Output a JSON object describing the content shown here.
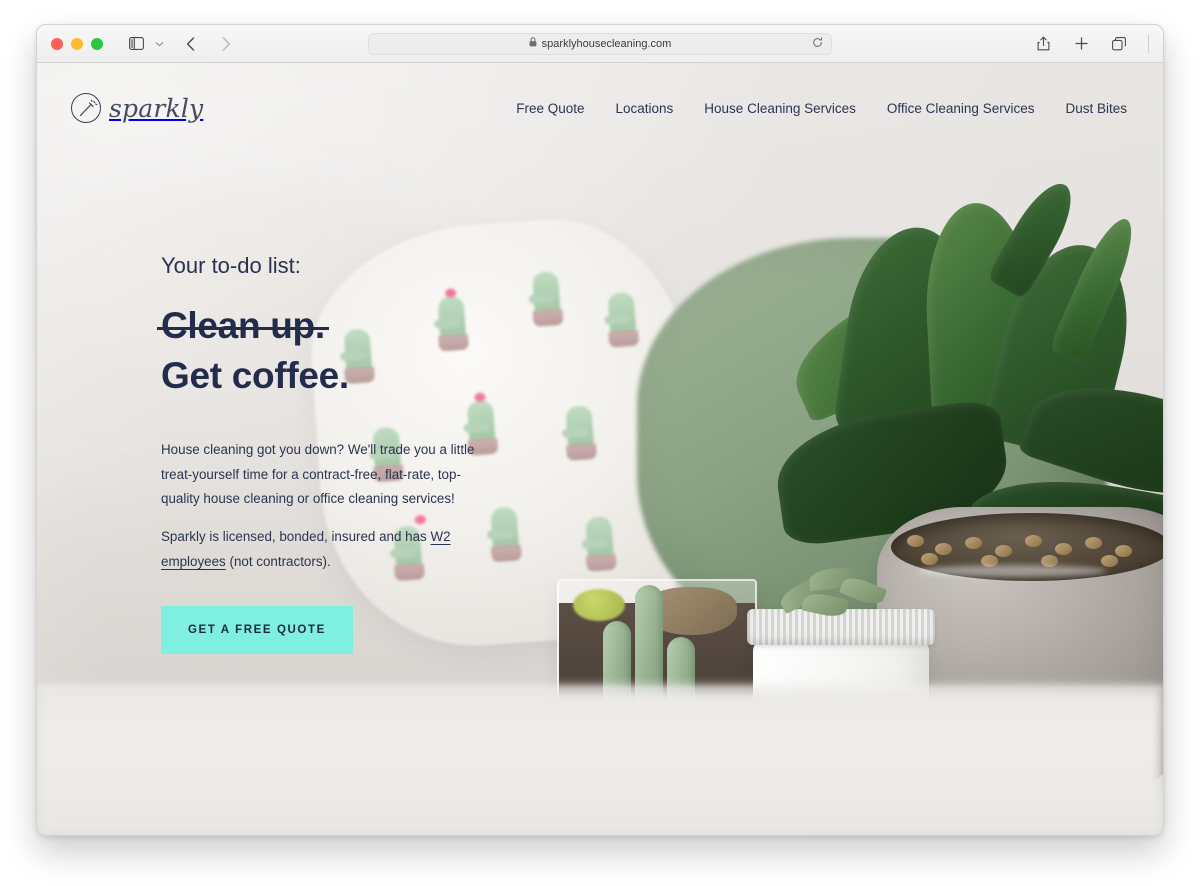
{
  "browser": {
    "traffic_lights": [
      "close",
      "minimize",
      "maximize"
    ],
    "sidebar_label": "Sidebar",
    "back_label": "Back",
    "forward_label": "Forward",
    "url": "sparklyhousecleaning.com",
    "lock_icon": "lock-icon",
    "reload_icon": "reload-icon",
    "share_icon": "share-icon",
    "new_tab_icon": "plus-icon",
    "tabs_icon": "tab-overview-icon"
  },
  "site": {
    "logo_text": "sparkly",
    "logo_icon": "magic-wand-icon",
    "nav": [
      {
        "label": "Free Quote"
      },
      {
        "label": "Locations"
      },
      {
        "label": "House Cleaning Services"
      },
      {
        "label": "Office Cleaning Services"
      },
      {
        "label": "Dust Bites"
      }
    ]
  },
  "hero": {
    "kicker": "Your to-do list:",
    "headline_struck": "Clean up.",
    "headline_main": "Get coffee.",
    "paragraph_1": "House cleaning got you down? We'll trade you a little treat-yourself time for a contract-free, flat-rate, top-quality house cleaning or office cleaning services!",
    "paragraph_2_before": "Sparkly is licensed, bonded, insured and has ",
    "paragraph_2_link": "W2 employees",
    "paragraph_2_after": " (not contractors).",
    "cta_label": "GET A FREE QUOTE"
  },
  "colors": {
    "accent_mint": "#7ff0e0",
    "text_navy": "#232c4b",
    "page_background": "#e7e5e3"
  }
}
